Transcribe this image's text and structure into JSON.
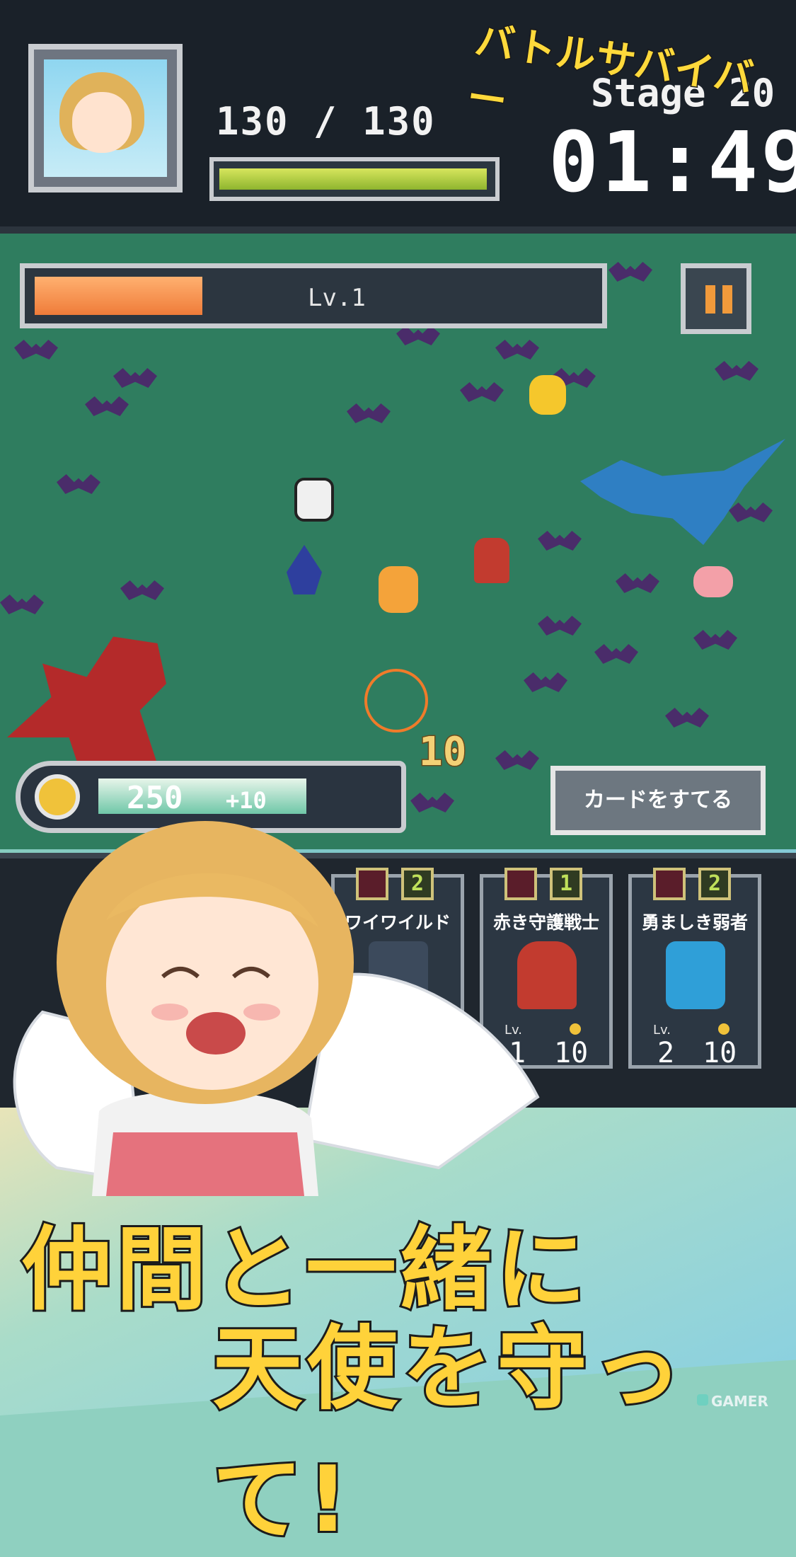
{
  "title_banner": "バトルサバイバー",
  "hud": {
    "hp_current": 130,
    "hp_max": 130,
    "hp_text": "130 / 130",
    "hp_fraction": 1.0,
    "stage_text": "Stage 20",
    "timer": "01:49"
  },
  "level": {
    "label": "Lv.1",
    "progress_fraction": 0.3
  },
  "coins": {
    "value": "250",
    "bonus": "+10",
    "progress_fraction": 0.7
  },
  "discard_button": "カードをすてる",
  "floating_damage": "10",
  "cards": [
    {
      "name": "ワイワイルド",
      "type_icon": "sword-icon",
      "cost_badge": "2",
      "lv_label": "Lv.",
      "lv": "",
      "cost": ""
    },
    {
      "name": "赤き守護戦士",
      "type_icon": "shield-icon",
      "cost_badge": "1",
      "lv_label": "Lv.",
      "lv": "1",
      "cost": "10"
    },
    {
      "name": "勇ましき弱者",
      "type_icon": "sword-icon",
      "cost_badge": "2",
      "lv_label": "Lv.",
      "lv": "2",
      "cost": "10"
    }
  ],
  "headline": {
    "line1": "仲間と一緒に",
    "line2": "天使を守って!"
  },
  "watermark": "GAMER",
  "colors": {
    "hud_bg": "#1a2129",
    "field_bg": "#2f7d5f",
    "hp_fill": "#c9dc4a",
    "level_fill": "#ef7c3a",
    "title_yellow": "#ffd93b"
  }
}
